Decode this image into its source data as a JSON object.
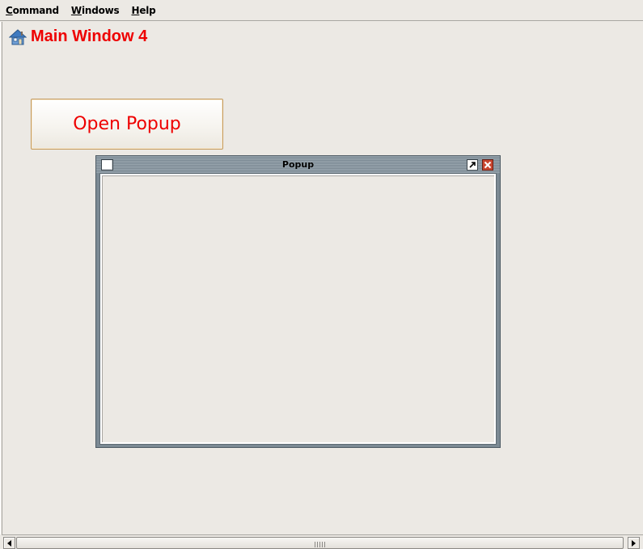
{
  "menubar": {
    "items": [
      {
        "label": "Command",
        "mnemonic": "C",
        "rest": "ommand"
      },
      {
        "label": "Windows",
        "mnemonic": "W",
        "rest": "indows"
      },
      {
        "label": "Help",
        "mnemonic": "H",
        "rest": "elp"
      }
    ]
  },
  "main": {
    "title": "Main Window 4",
    "title_icon": "home-icon",
    "open_button_label": "Open Popup"
  },
  "popup": {
    "title": "Popup",
    "icons": [
      "window-menu-icon",
      "maximize-icon",
      "close-icon"
    ]
  },
  "scrollbar": {
    "orientation": "horizontal",
    "icons": [
      "arrow-left-icon",
      "arrow-right-icon"
    ]
  },
  "colors": {
    "accent_text": "#ee0000",
    "background": "#ece9e4",
    "popup_frame": "#7c8a94",
    "close_button": "#c8452f"
  }
}
